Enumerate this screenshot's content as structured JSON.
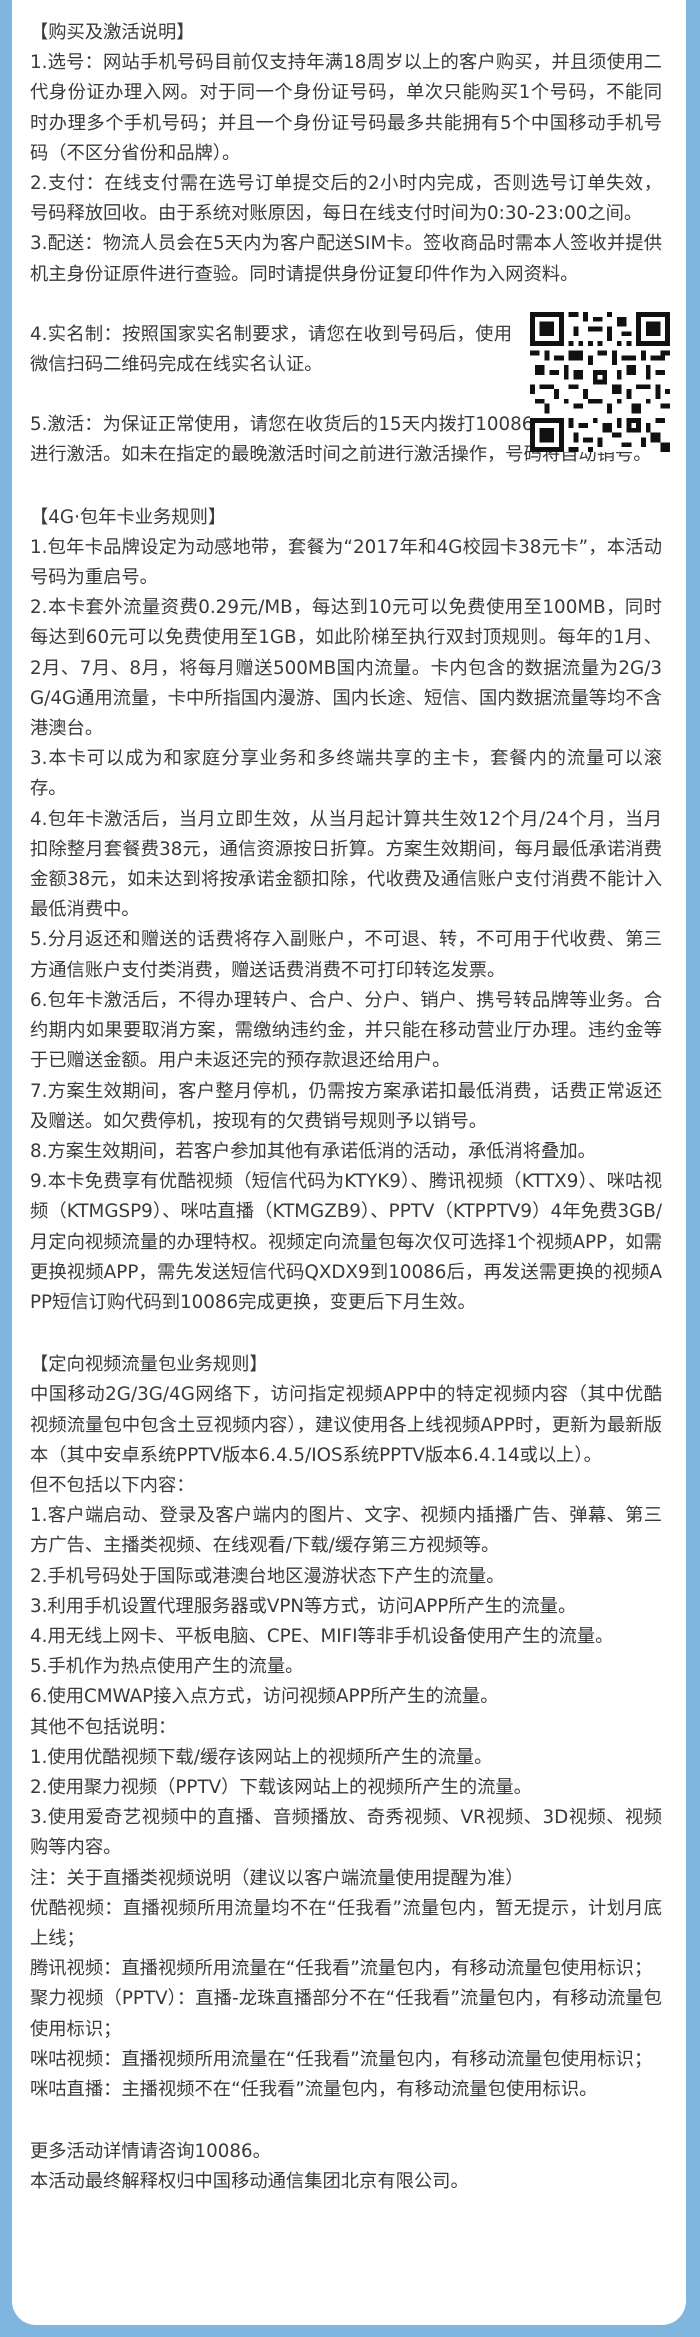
{
  "purchase": {
    "heading": "【购买及激活说明】",
    "items": [
      "1.选号：网站手机号码目前仅支持年满18周岁以上的客户购买，并且须使用二代身份证办理入网。对于同一个身份证号码，单次只能购买1个号码，不能同时办理多个手机号码；并且一个身份证号码最多共能拥有5个中国移动手机号码（不区分省份和品牌）。",
      "2.支付：在线支付需在选号订单提交后的2小时内完成，否则选号订单失效，号码释放回收。由于系统对账原因，每日在线支付时间为0:30-23:00之间。",
      "3.配送：物流人员会在5天内为客户配送SIM卡。签收商品时需本人签收并提供机主身份证原件进行查验。同时请提供身份证复印件作为入网资料。",
      "4.实名制：按照国家实名制要求，请您在收到号码后，使用微信扫码二维码完成在线实名认证。",
      "5.激活：为保证正常使用，请您在收货后的15天内拨打10086并按照语音提示进行激活。如未在指定的最晚激活时间之前进行激活操作，号码将自动销号。"
    ]
  },
  "plan": {
    "heading": "【4G·包年卡业务规则】",
    "items": [
      "1.包年卡品牌设定为动感地带，套餐为“2017年和4G校园卡38元卡”，本活动号码为重启号。",
      "2.本卡套外流量资费0.29元/MB，每达到10元可以免费使用至100MB，同时每达到60元可以免费使用至1GB，如此阶梯至执行双封顶规则。每年的1月、2月、7月、8月，将每月赠送500MB国内流量。卡内包含的数据流量为2G/3G/4G通用流量，卡中所指国内漫游、国内长途、短信、国内数据流量等均不含港澳台。",
      "3.本卡可以成为和家庭分享业务和多终端共享的主卡，套餐内的流量可以滚存。",
      "4.包年卡激活后，当月立即生效，从当月起计算共生效12个月/24个月，当月扣除整月套餐费38元，通信资源按日折算。方案生效期间，每月最低承诺消费金额38元，如未达到将按承诺金额扣除，代收费及通信账户支付消费不能计入最低消费中。",
      "5.分月返还和赠送的话费将存入副账户，不可退、转，不可用于代收费、第三方通信账户支付类消费，赠送话费消费不可打印转迄发票。",
      "6.包年卡激活后，不得办理转户、合户、分户、销户、携号转品牌等业务。合约期内如果要取消方案，需缴纳违约金，并只能在移动营业厅办理。违约金等于已赠送金额。用户未返还完的预存款退还给用户。",
      "7.方案生效期间，客户整月停机，仍需按方案承诺扣最低消费，话费正常返还及赠送。如欠费停机，按现有的欠费销号规则予以销号。",
      "8.方案生效期间，若客户参加其他有承诺低消的活动，承低消将叠加。",
      "9.本卡免费享有优酷视频（短信代码为KTYK9）、腾讯视频（KTTX9）、咪咕视频（KTMGSP9）、咪咕直播（KTMGZB9）、PPTV（KTPPTV9）4年免费3GB/月定向视频流量的办理特权。视频定向流量包每次仅可选择1个视频APP，如需更换视频APP，需先发送短信代码QXDX9到10086后，再发送需更换的视频APP短信订购代码到10086完成更换，变更后下月生效。"
    ]
  },
  "video": {
    "heading": "【定向视频流量包业务规则】",
    "intro": "中国移动2G/3G/4G网络下，访问指定视频APP中的特定视频内容（其中优酷视频流量包中包含土豆视频内容），建议使用各上线视频APP时，更新为最新版本（其中安卓系统PPTV版本6.4.5/IOS系统PPTV版本6.4.14或以上）。",
    "excludes_heading": "但不包括以下内容：",
    "excludes": [
      "1.客户端启动、登录及客户端内的图片、文字、视频内插播广告、弹幕、第三方广告、主播类视频、在线观看/下载/缓存第三方视频等。",
      "2.手机号码处于国际或港澳台地区漫游状态下产生的流量。",
      "3.利用手机设置代理服务器或VPN等方式，访问APP所产生的流量。",
      "4.用无线上网卡、平板电脑、CPE、MIFI等非手机设备使用产生的流量。",
      "5.手机作为热点使用产生的流量。",
      "6.使用CMWAP接入点方式，访问视频APP所产生的流量。"
    ],
    "other_heading": "其他不包括说明：",
    "other": [
      "1.使用优酷视频下载/缓存该网站上的视频所产生的流量。",
      "2.使用聚力视频（PPTV）下载该网站上的视频所产生的流量。",
      "3.使用爱奇艺视频中的直播、音频播放、奇秀视频、VR视频、3D视频、视频购等内容。"
    ],
    "note_heading": "注：关于直播类视频说明（建议以客户端流量使用提醒为准）",
    "notes": [
      "优酷视频：直播视频所用流量均不在“任我看”流量包内，暂无提示，计划月底上线；",
      "腾讯视频：直播视频所用流量在“任我看”流量包内，有移动流量包使用标识；",
      "聚力视频（PPTV）：直播-龙珠直播部分不在“任我看”流量包内，有移动流量包使用标识；",
      "咪咕视频：直播视频所用流量在“任我看”流量包内，有移动流量包使用标识；",
      "咪咕直播：主播视频不在“任我看”流量包内，有移动流量包使用标识。"
    ]
  },
  "footer": {
    "consult": "更多活动详情请咨询10086。",
    "rights": "本活动最终解释权归中国移动通信集团北京有限公司。"
  }
}
